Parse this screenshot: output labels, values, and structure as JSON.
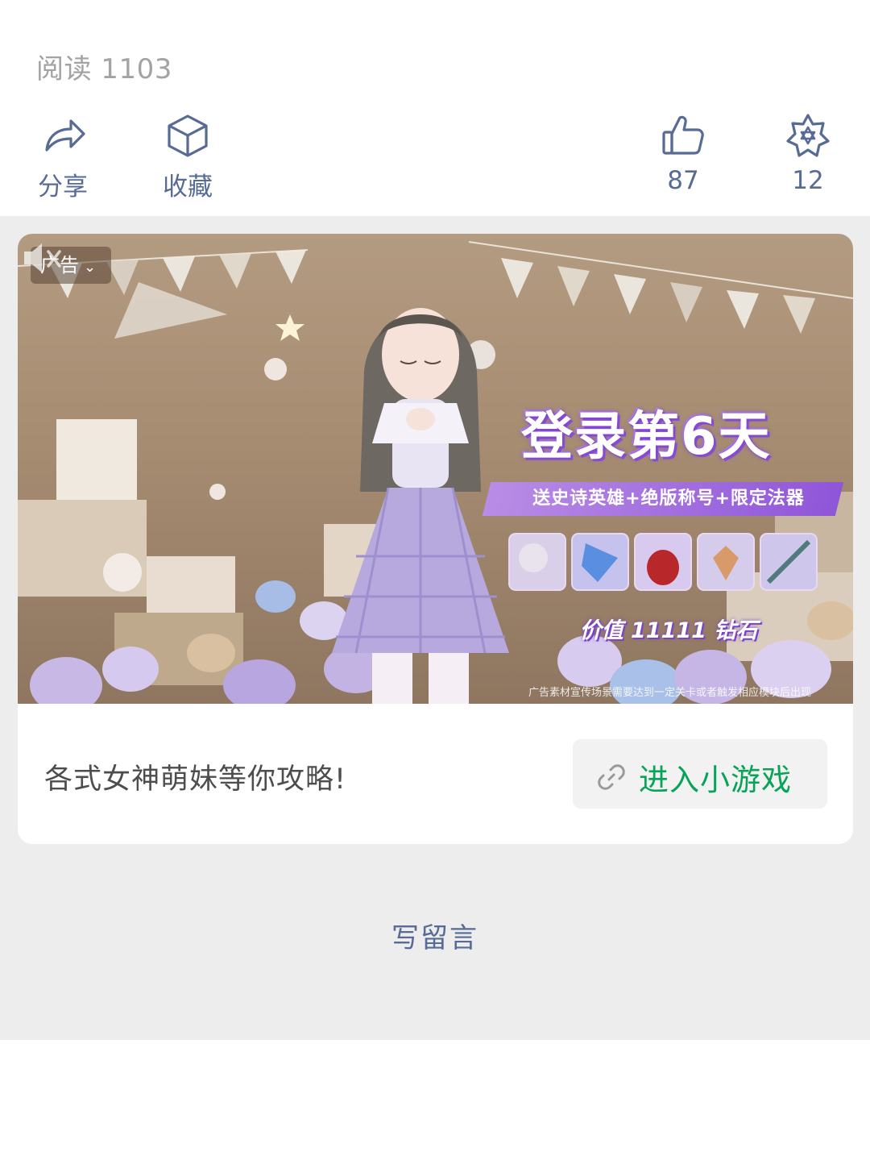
{
  "stats": {
    "read_label": "阅读 1103"
  },
  "actions": {
    "share_label": "分享",
    "favorite_label": "收藏",
    "like_count": "87",
    "wow_count": "12",
    "icons": [
      "share-icon",
      "favorite-cube-icon",
      "thumbs-up-icon",
      "wow-star-icon"
    ]
  },
  "ad": {
    "tag_label": "广告",
    "promo_title": "登录第6天",
    "promo_subtitle": "送史诗英雄+绝版称号+限定法器",
    "promo_value": "价值 11111 钻石",
    "disclaimer": "广告素材宣传场景需要达到一定关卡或者触发相应模块后出现",
    "caption": "各式女神萌妹等你攻略!",
    "button_label": "进入小游戏"
  },
  "comment": {
    "write_label": "写留言"
  },
  "colors": {
    "link_blue": "#576b95",
    "mini_program_green": "#07a359",
    "background_gray": "#ededed"
  }
}
